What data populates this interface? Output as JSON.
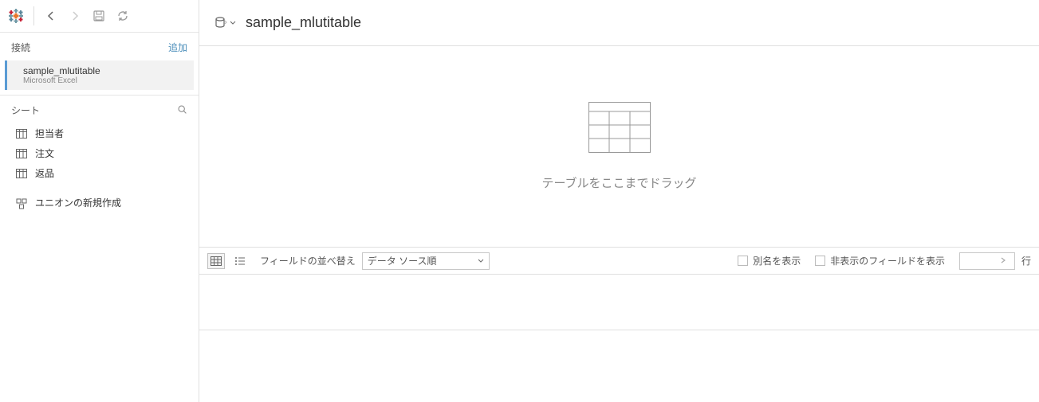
{
  "toolbar": {
    "icons": {
      "back": "back-icon",
      "forward": "forward-icon",
      "save": "save-icon",
      "refresh": "refresh-icon"
    }
  },
  "sidebar": {
    "connections_label": "接続",
    "add_label": "追加",
    "connection": {
      "name": "sample_mlutitable",
      "type": "Microsoft Excel"
    },
    "sheets_label": "シート",
    "sheets": [
      {
        "label": "担当者"
      },
      {
        "label": "注文"
      },
      {
        "label": "返品"
      }
    ],
    "union_label": "ユニオンの新規作成"
  },
  "main": {
    "datasource_name": "sample_mlutitable",
    "drop_hint": "テーブルをここまでドラッグ"
  },
  "options": {
    "sort_label": "フィールドの並べ替え",
    "sort_value": "データ ソース順",
    "show_alias_label": "別名を表示",
    "show_hidden_label": "非表示のフィールドを表示",
    "rows_value": "",
    "rows_label": "行"
  }
}
